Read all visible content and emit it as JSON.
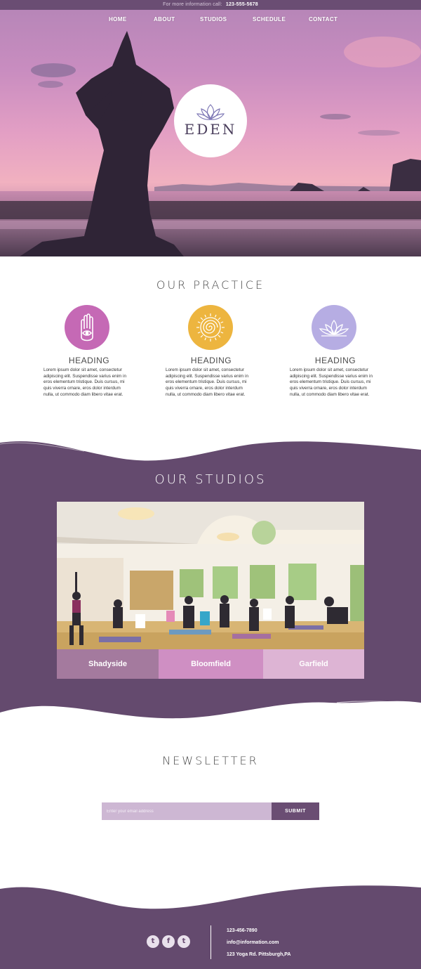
{
  "topbar": {
    "text": "For more information call:",
    "phone": "123-555-5678"
  },
  "nav": {
    "items": [
      "HOME",
      "ABOUT",
      "STUDIOS",
      "SCHEDULE",
      "CONTACT"
    ]
  },
  "hero": {
    "logo_text": "EDEN"
  },
  "practice": {
    "title": "OUR PRACTICE",
    "features": [
      {
        "heading": "HEADING",
        "icon": "hamsa-hand-icon",
        "color": "#c569b5",
        "body": "Lorem ipsum dolor sit amet, consectetur adipiscing elit. Suspendisse varius enim in eros elementum tristique. Duis cursus, mi quis viverra ornare, eros dolor interdum nulla, ut commodo diam libero vitae erat."
      },
      {
        "heading": "HEADING",
        "icon": "sun-spiral-icon",
        "color": "#edb53f",
        "body": "Lorem ipsum dolor sit amet, consectetur adipiscing elit. Suspendisse varius enim in eros elementum tristique. Duis cursus, mi quis viverra ornare, eros dolor interdum nulla, ut commodo diam libero vitae erat."
      },
      {
        "heading": "HEADING",
        "icon": "lotus-icon",
        "color": "#b6ade3",
        "body": "Lorem ipsum dolor sit amet, consectetur adipiscing elit. Suspendisse varius enim in eros elementum tristique. Duis cursus, mi quis viverra ornare, eros dolor interdum nulla, ut commodo diam libero vitae erat."
      }
    ]
  },
  "studios": {
    "title": "OUR STUDIOS",
    "tabs": [
      {
        "label": "Shadyside",
        "color": "#a47a9e"
      },
      {
        "label": "Bloomfield",
        "color": "#cf8fc3"
      },
      {
        "label": "Garfield",
        "color": "#ddb4d4"
      }
    ]
  },
  "newsletter": {
    "title": "NEWSLETTER",
    "placeholder": "Enter your email address",
    "submit_label": "SUBMIT"
  },
  "footer": {
    "social": [
      "twitter-icon",
      "facebook-icon",
      "tumblr-icon"
    ],
    "phone": "123-456-7890",
    "email": "info@information.com",
    "address": "123 Yoga Rd. Pittsburgh,PA"
  },
  "colors": {
    "brand_purple": "#6a4d73",
    "band_purple": "#644a6e"
  }
}
